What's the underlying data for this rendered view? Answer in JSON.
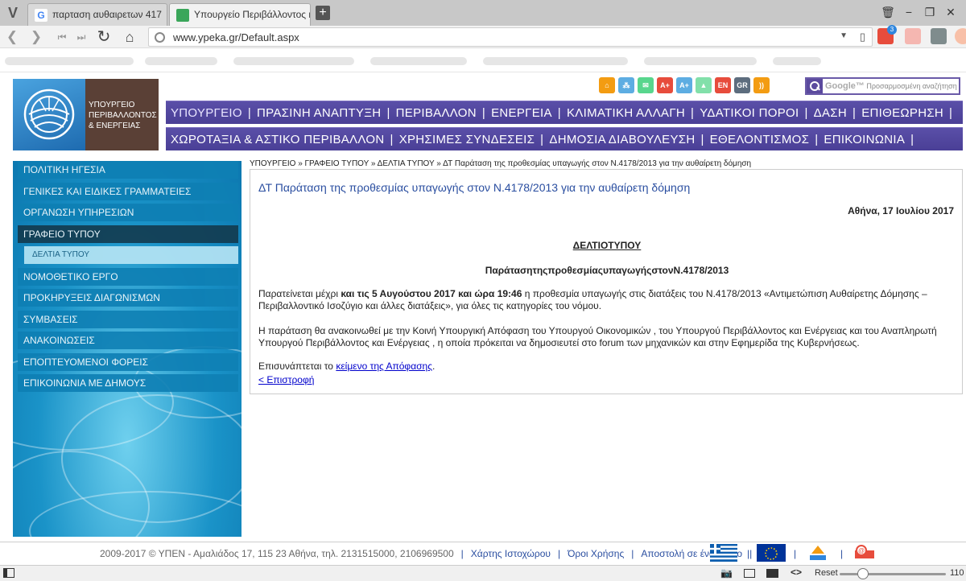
{
  "browser": {
    "tabs": [
      {
        "label": "παρταση αυθαιρετων 417",
        "active": false
      },
      {
        "label": "Υπουργείο Περιβάλλοντος κ",
        "active": true
      }
    ],
    "url": "www.ypeka.gr/Default.aspx",
    "notification_count": "3",
    "zoom_reset_label": "Reset",
    "zoom_value": "110"
  },
  "site": {
    "logo_lines": [
      "ΥΠΟΥΡΓΕΙΟ",
      "ΠΕΡΙΒΑΛΛΟΝΤΟΣ",
      "& ΕΝΕΡΓΕΙΑΣ"
    ],
    "toolbar_labels": [
      "A+",
      "A+",
      "EN",
      "GR"
    ],
    "search_brand": "Google™",
    "search_placeholder": "Προσαρμοσμένη αναζήτηση",
    "menu_row1": [
      "ΥΠΟΥΡΓΕΙΟ",
      "ΠΡΑΣΙΝΗ ΑΝΑΠΤΥΞΗ",
      "ΠΕΡΙΒΑΛΛΟΝ",
      "ΕΝΕΡΓΕΙΑ",
      "ΚΛΙΜΑΤΙΚΗ ΑΛΛΑΓΗ",
      "ΥΔΑΤΙΚΟΙ ΠΟΡΟΙ",
      "ΔΑΣΗ",
      "ΕΠΙΘΕΩΡΗΣΗ"
    ],
    "menu_row2": [
      "ΧΩΡΟΤΑΞΙΑ & ΑΣΤΙΚΟ ΠΕΡΙΒΑΛΛΟΝ",
      "ΧΡΗΣΙΜΕΣ ΣΥΝΔΕΣΕΙΣ",
      "ΔΗΜΟΣΙΑ ΔΙΑΒΟΥΛΕΥΣΗ",
      "ΕΘΕΛΟΝΤΙΣΜΟΣ",
      "ΕΠΙΚΟΙΝΩΝΙΑ"
    ],
    "sidebar": [
      {
        "label": "ΠΟΛΙΤΙΚΗ ΗΓΕΣΙΑ",
        "type": "normal"
      },
      {
        "label": "ΓΕΝΙΚΕΣ ΚΑΙ ΕΙΔΙΚΕΣ ΓΡΑΜΜΑΤΕΙΕΣ",
        "type": "normal"
      },
      {
        "label": "ΟΡΓΑΝΩΣΗ ΥΠΗΡΕΣΙΩΝ",
        "type": "normal"
      },
      {
        "label": "ΓΡΑΦΕΙΟ ΤΥΠΟΥ",
        "type": "active"
      },
      {
        "label": "ΔΕΛΤΙΑ ΤΥΠΟΥ",
        "type": "sub"
      },
      {
        "label": "ΝΟΜΟΘΕΤΙΚΟ ΕΡΓΟ",
        "type": "normal"
      },
      {
        "label": "ΠΡΟΚΗΡΥΞΕΙΣ ΔΙΑΓΩΝΙΣΜΩΝ",
        "type": "normal"
      },
      {
        "label": "ΣΥΜΒΑΣΕΙΣ",
        "type": "normal"
      },
      {
        "label": "ΑΝΑΚΟΙΝΩΣΕΙΣ",
        "type": "normal"
      },
      {
        "label": "ΕΠΟΠΤΕΥΟΜΕΝΟΙ ΦΟΡΕΙΣ",
        "type": "normal"
      },
      {
        "label": "ΕΠΙΚΟΙΝΩΝΙΑ ΜΕ ΔΗΜΟΥΣ",
        "type": "normal"
      }
    ],
    "breadcrumb": "ΥΠΟΥΡΓΕΙΟ » ΓΡΑΦΕΙΟ ΤΥΠΟΥ » ΔΕΛΤΙΑ ΤΥΠΟΥ » ΔΤ Παράταση της προθεσμίας υπαγωγής στον Ν.4178/2013 για την αυθαίρετη δόμηση",
    "article": {
      "title": "ΔΤ Παράταση της προθεσμίας υπαγωγής στον Ν.4178/2013 για την αυθαίρετη δόμηση",
      "date": "Αθήνα,   17 Ιουλίου 2017",
      "heading": "ΔΕΛΤΙΟΤΥΠΟΥ",
      "subheading": "ΠαράτασητηςπροθεσμίαςυπαγωγήςστονΝ.4178/2013",
      "p1_a": "Παρατείνεται μέχρι ",
      "p1_bold": "και τις 5 Αυγούστου 2017 και ώρα 19:46",
      "p1_b": " η προθεσμία υπαγωγής στις διατάξεις του Ν.4178/2013 «Αντιμετώπιση Αυθαίρετης Δόμησης – Περιβαλλοντικό Ισοζύγιο και άλλες διατάξεις»,  για όλες τις κατηγορίες του νόμου.",
      "p2": "Η παράταση θα ανακοινωθεί με την Κοινή Υπουργική Απόφαση του Υπουργού Οικονομικών ,  του Υπουργού Περιβάλλοντος και   Ενέργειας και του Αναπληρωτή Υπουργού Περιβάλλοντος και Ενέργειας , η οποία πρόκειται να δημοσιευτεί στο forum των μηχανικών και στην Εφημερίδα της Κυβερνήσεως.",
      "p3_text": "Επισυνάπτεται το ",
      "p3_link": "κείμενο της Απόφασης",
      "p3_end": ".",
      "back": "< Επιστροφή"
    },
    "footer": {
      "copyright": "2009-2017 © ΥΠΕΝ - Αμαλιάδος 17, 115 23 Αθήνα, τηλ. 2131515000, 2106969500",
      "links": [
        "Χάρτης Ιστοχώρου",
        "Όροι Χρήσης",
        "Αποστολή σε έναν Φίλο"
      ]
    }
  }
}
